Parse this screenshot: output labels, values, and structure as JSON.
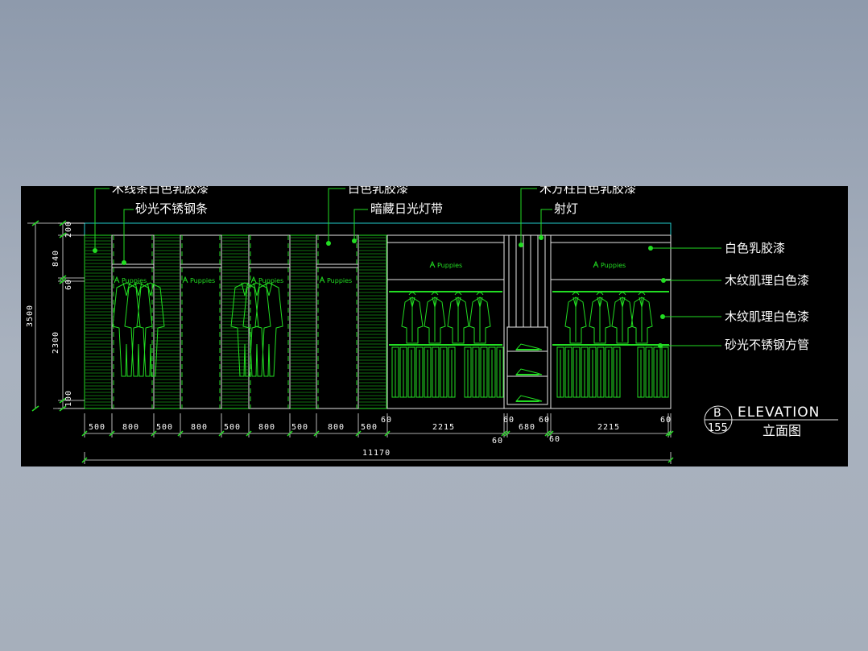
{
  "drawing": {
    "callouts_top": [
      "木线条白色乳胶漆",
      "砂光不锈钢条",
      "白色乳胶漆",
      "暗藏日光灯带",
      "木方柱白色乳胶漆",
      "射灯"
    ],
    "callouts_right": [
      "白色乳胶漆",
      "木纹肌理白色漆",
      "木纹肌理白色漆",
      "砂光不锈钢方管"
    ],
    "brand": "Puppies",
    "dims_left": [
      "200",
      "840",
      "60",
      "2300",
      "100"
    ],
    "dim_total_height": "3500",
    "dims_bottom": [
      "500",
      "800",
      "500",
      "800",
      "500",
      "800",
      "500",
      "800",
      "500",
      "60",
      "2215",
      "60",
      "680",
      "60",
      "2215",
      "60"
    ],
    "dims_bottom_sub": [
      "60",
      "60"
    ],
    "dim_total_width": "11170",
    "title": {
      "bubble_letter": "B",
      "bubble_number": "155",
      "en": "ELEVATION",
      "cn": "立面图"
    },
    "line_color": "#22dd22",
    "text_color": "#ffffff"
  }
}
